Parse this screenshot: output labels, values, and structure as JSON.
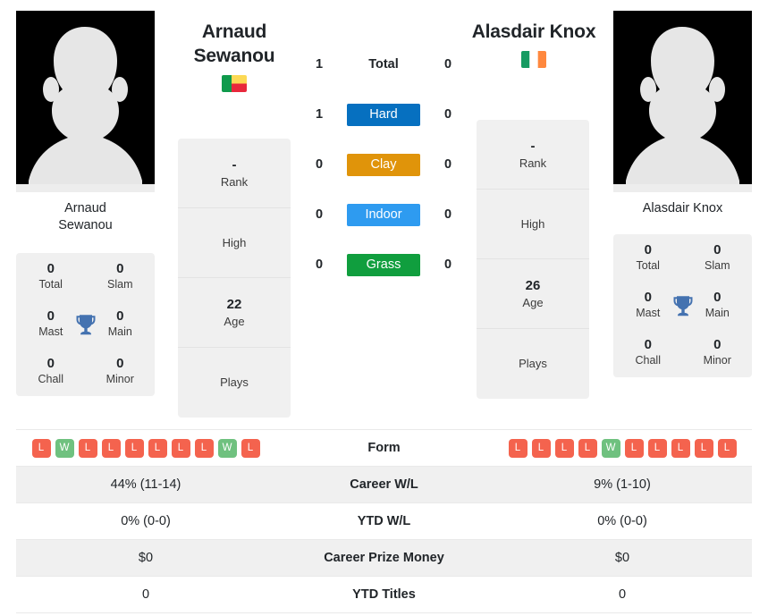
{
  "players": {
    "left": {
      "name": "Arnaud Sewanou",
      "name_line1": "Arnaud",
      "name_line2": "Sewanou",
      "caption_line1": "Arnaud",
      "caption_line2": "Sewanou",
      "flag": "benin-flag",
      "flag_colors": [
        "#0F9A4C",
        "#FCD955",
        "#E8283C"
      ],
      "avatar": "player-silhouette-placeholder",
      "info": {
        "rank_value": "-",
        "rank_label": "Rank",
        "high_value": "",
        "high_label": "High",
        "age_value": "22",
        "age_label": "Age",
        "plays_value": "",
        "plays_label": "Plays"
      },
      "titles": {
        "total_value": "0",
        "total_label": "Total",
        "slam_value": "0",
        "slam_label": "Slam",
        "mast_value": "0",
        "mast_label": "Mast",
        "main_value": "0",
        "main_label": "Main",
        "chall_value": "0",
        "chall_label": "Chall",
        "minor_value": "0",
        "minor_label": "Minor"
      },
      "form": [
        "L",
        "W",
        "L",
        "L",
        "L",
        "L",
        "L",
        "L",
        "W",
        "L"
      ],
      "career_wl": "44% (11-14)",
      "ytd_wl": "0% (0-0)",
      "career_prize_money": "$0",
      "ytd_titles": "0"
    },
    "right": {
      "name": "Alasdair Knox",
      "name_line1": "Alasdair Knox",
      "caption_line1": "Alasdair Knox",
      "flag": "ireland-flag",
      "flag_colors": [
        "#169B62",
        "#FFFFFF",
        "#FF883E"
      ],
      "avatar": "player-silhouette-placeholder",
      "info": {
        "rank_value": "-",
        "rank_label": "Rank",
        "high_value": "",
        "high_label": "High",
        "age_value": "26",
        "age_label": "Age",
        "plays_value": "",
        "plays_label": "Plays"
      },
      "titles": {
        "total_value": "0",
        "total_label": "Total",
        "slam_value": "0",
        "slam_label": "Slam",
        "mast_value": "0",
        "mast_label": "Mast",
        "main_value": "0",
        "main_label": "Main",
        "chall_value": "0",
        "chall_label": "Chall",
        "minor_value": "0",
        "minor_label": "Minor"
      },
      "form": [
        "L",
        "L",
        "L",
        "L",
        "W",
        "L",
        "L",
        "L",
        "L",
        "L"
      ],
      "career_wl": "9% (1-10)",
      "ytd_wl": "0% (0-0)",
      "career_prize_money": "$0",
      "ytd_titles": "0"
    }
  },
  "head_to_head": {
    "rows": [
      {
        "left": "1",
        "label": "Total",
        "right": "0",
        "badge": false,
        "color": ""
      },
      {
        "left": "1",
        "label": "Hard",
        "right": "0",
        "badge": true,
        "color": "#0670C0"
      },
      {
        "left": "0",
        "label": "Clay",
        "right": "0",
        "badge": true,
        "color": "#E0940A"
      },
      {
        "left": "0",
        "label": "Indoor",
        "right": "0",
        "badge": true,
        "color": "#2E9BF0"
      },
      {
        "left": "0",
        "label": "Grass",
        "right": "0",
        "badge": true,
        "color": "#109E3E"
      }
    ]
  },
  "stats_table": {
    "rows": [
      {
        "label": "Form",
        "type": "form",
        "shaded": false
      },
      {
        "label": "Career W/L",
        "type": "text",
        "shaded": true,
        "left": "44% (11-14)",
        "right": "9% (1-10)"
      },
      {
        "label": "YTD W/L",
        "type": "text",
        "shaded": false,
        "left": "0% (0-0)",
        "right": "0% (0-0)"
      },
      {
        "label": "Career Prize Money",
        "type": "text",
        "shaded": true,
        "left": "$0",
        "right": "$0"
      },
      {
        "label": "YTD Titles",
        "type": "text",
        "shaded": false,
        "left": "0",
        "right": "0"
      }
    ]
  },
  "icons": {
    "trophy": "trophy-icon",
    "trophy_color": "#4472B0"
  },
  "colors": {
    "card_bg": "#f0f0f0",
    "win_badge": "#6fc17f",
    "loss_badge": "#f4634e",
    "text": "#212529"
  }
}
